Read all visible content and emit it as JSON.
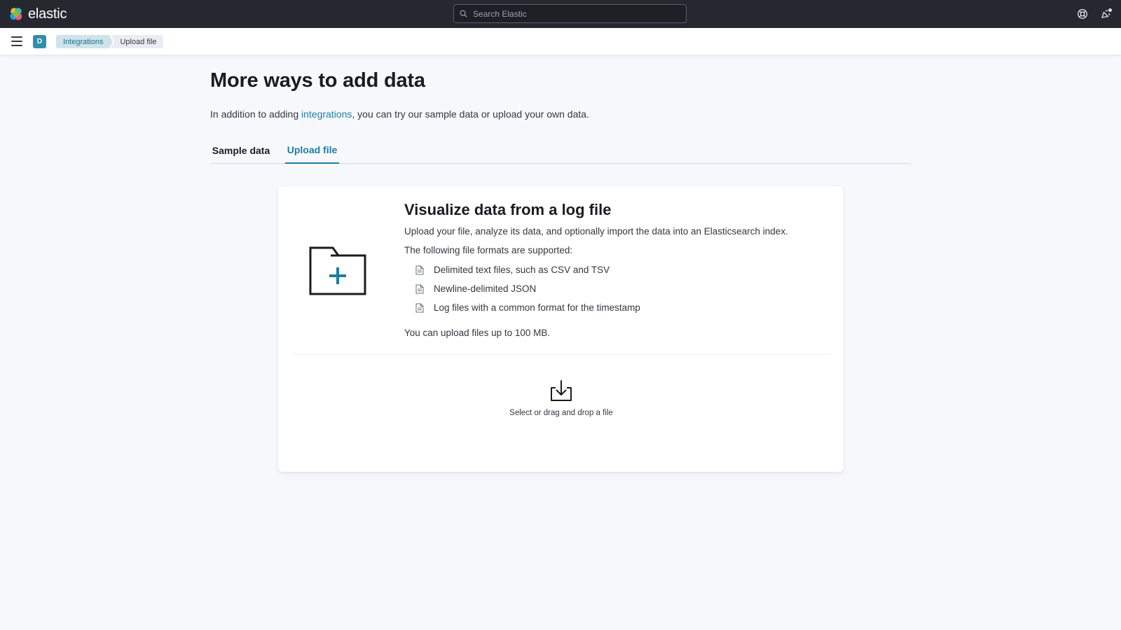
{
  "header": {
    "brand": "elastic",
    "search_placeholder": "Search Elastic",
    "icons": [
      "help-icon",
      "newsfeed-icon"
    ]
  },
  "subheader": {
    "menu_icon": "hamburger-icon",
    "space_initial": "D",
    "space_color": "#2f8fa8",
    "breadcrumbs": [
      {
        "label": "Integrations"
      },
      {
        "label": "Upload file"
      }
    ]
  },
  "main": {
    "title": "More ways to add data",
    "intro_before": "In addition to adding ",
    "intro_link": "integrations",
    "intro_after": ", you can try our sample data or upload your own data.",
    "tabs": [
      {
        "label": "Sample data",
        "selected": false
      },
      {
        "label": "Upload file",
        "selected": true
      }
    ]
  },
  "upload_panel": {
    "title": "Visualize data from a log file",
    "description": "Upload your file, analyze its data, and optionally import the data into an Elasticsearch index.",
    "formats_intro": "The following file formats are supported:",
    "formats": [
      "Delimited text files, such as CSV and TSV",
      "Newline-delimited JSON",
      "Log files with a common format for the timestamp"
    ],
    "size_limit": "You can upload files up to 100 MB.",
    "dropzone_label": "Select or drag and drop a file"
  },
  "colors": {
    "accent": "#1e7ea0",
    "header_bg": "#25282f",
    "page_bg": "#f7f8fc",
    "text": "#1a1c21"
  }
}
